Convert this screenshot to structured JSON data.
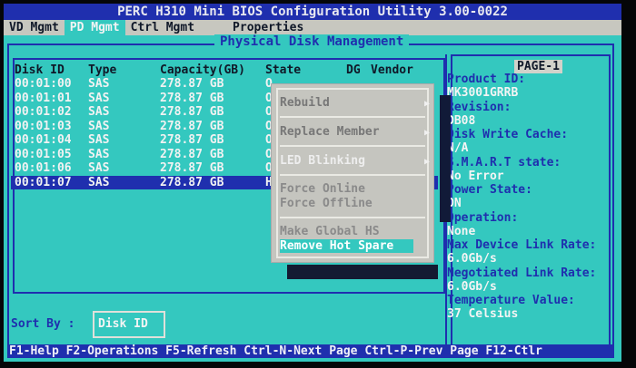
{
  "title": "PERC H310 Mini BIOS Configuration Utility 3.00-0022",
  "tabs": [
    "VD Mgmt",
    "PD Mgmt",
    "Ctrl Mgmt",
    "Properties"
  ],
  "section_title": "Physical Disk Management",
  "columns": [
    "Disk ID",
    "Type",
    "Capacity(GB)",
    "State",
    "DG",
    "Vendor"
  ],
  "rows": [
    {
      "id": "00:01:00",
      "type": "SAS",
      "cap": "278.87 GB",
      "state": "O"
    },
    {
      "id": "00:01:01",
      "type": "SAS",
      "cap": "278.87 GB",
      "state": "O"
    },
    {
      "id": "00:01:02",
      "type": "SAS",
      "cap": "278.87 GB",
      "state": "O"
    },
    {
      "id": "00:01:03",
      "type": "SAS",
      "cap": "278.87 GB",
      "state": "O"
    },
    {
      "id": "00:01:04",
      "type": "SAS",
      "cap": "278.87 GB",
      "state": "O"
    },
    {
      "id": "00:01:05",
      "type": "SAS",
      "cap": "278.87 GB",
      "state": "O"
    },
    {
      "id": "00:01:06",
      "type": "SAS",
      "cap": "278.87 GB",
      "state": "O"
    },
    {
      "id": "00:01:07",
      "type": "SAS",
      "cap": "278.87 GB",
      "state": "H"
    }
  ],
  "menu": {
    "rebuild": "Rebuild",
    "replace": "Replace Member",
    "led": "LED Blinking",
    "force_online": "Force Online",
    "force_offline": "Force Offline",
    "make_hs": "Make Global HS",
    "remove_hs": "Remove Hot Spare"
  },
  "info": {
    "page": "PAGE-1",
    "items": [
      {
        "label": "Product ID:",
        "value": "MK3001GRRB"
      },
      {
        "label": "Revision:",
        "value": "DB08"
      },
      {
        "label": "Disk Write Cache:",
        "value": "N/A"
      },
      {
        "label": "S.M.A.R.T state:",
        "value": "No Error"
      },
      {
        "label": "Power State:",
        "value": "ON"
      },
      {
        "label": "Operation:",
        "value": "None"
      },
      {
        "label": "Max Device Link Rate:",
        "value": "6.0Gb/s"
      },
      {
        "label": "Negotiated Link Rate:",
        "value": "6.0Gb/s"
      },
      {
        "label": "Temperature Value:",
        "value": "37 Celsius"
      }
    ]
  },
  "sort": {
    "label": "Sort By :",
    "value": "Disk ID"
  },
  "footer": "F1-Help F2-Operations F5-Refresh Ctrl-N-Next Page Ctrl-P-Prev Page F12-Ctlr"
}
